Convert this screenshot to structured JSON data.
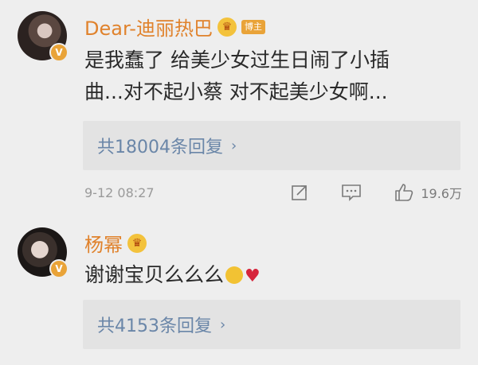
{
  "comments": [
    {
      "name": "Dear-迪丽热巴",
      "badge": "博主",
      "text_line1": "是我蠢了 给美少女过生日闹了小插",
      "text_line2": "曲...对不起小蔡 对不起美少女啊...",
      "replies": "共18004条回复",
      "time": "9-12 08:27",
      "likes": "19.6万"
    },
    {
      "name": "杨幂",
      "text": "谢谢宝贝么么么",
      "replies": "共4153条回复"
    }
  ],
  "verify_mark": "V",
  "colors": {
    "name": "#e0822c",
    "link": "#6a86a8",
    "badge": "#e9a338",
    "heart": "#d6243b"
  },
  "icons": [
    "share-icon",
    "comment-icon",
    "like-icon",
    "crown-icon",
    "verified-icon",
    "chevron-right-icon"
  ]
}
